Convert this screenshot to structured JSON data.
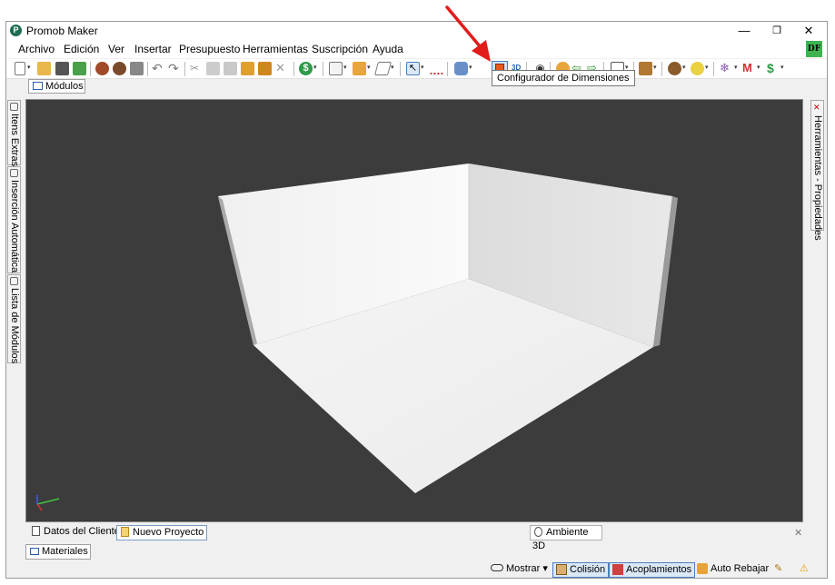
{
  "window": {
    "title": "Promob Maker",
    "controls": [
      "—",
      "❐",
      "✕"
    ]
  },
  "menu": [
    "Archivo",
    "Edición",
    "Ver",
    "Insertar",
    "Presupuesto",
    "Herramientas",
    "Suscripción",
    "Ayuda"
  ],
  "user_badge": "DF",
  "toolbar": {
    "highlighted_button": "configurador-dimensiones",
    "tooltip": "Configurador de Dimensiones",
    "btn_3d": "3D",
    "accent": "#e8581d"
  },
  "top_tab": "Módulos",
  "left_tabs": [
    "Itens Extras",
    "Inserción Automática",
    "Lista de Módulos"
  ],
  "right_tab": "Herramientas - Propiedades",
  "viewport": {
    "background": "#3c3c3c"
  },
  "bottom_tabs": {
    "datos": "Datos del Cliente",
    "nuevo": "Nuevo Proyecto",
    "ambiente": "Ambiente 3D",
    "close": "✕"
  },
  "materiales_tab": "Materiales",
  "status_bar": {
    "mostrar": "Mostrar",
    "colision": "Colisión",
    "acoplamientos": "Acoplamientos",
    "auto_rebajar": "Auto Rebajar"
  }
}
